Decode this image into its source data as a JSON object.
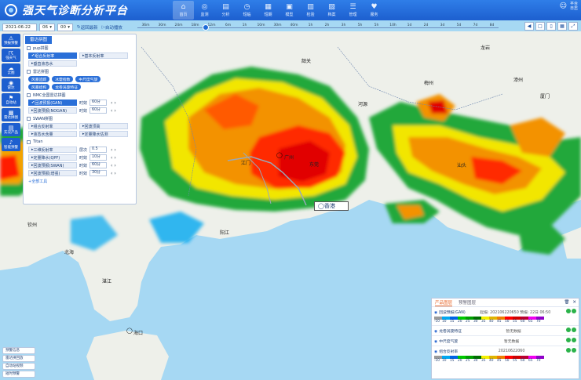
{
  "header": {
    "title": "强天气诊断分析平台",
    "nav": [
      "首页",
      "监测",
      "分析",
      "短临",
      "短期",
      "模型",
      "检验",
      "档案",
      "管理",
      "服务"
    ],
    "user": [
      "平台",
      "日志"
    ]
  },
  "timebar": {
    "date": "2021-06-22",
    "hour": "06",
    "minute": "00",
    "refresh_label": "返回最新",
    "auto_label": "自动播放",
    "ticks": [
      "36m",
      "30m",
      "24m",
      "18m",
      "12m",
      "6m",
      "1h",
      "10m",
      "30m",
      "40m",
      "1h",
      "2h",
      "3h",
      "5h",
      "5h",
      "10h",
      "1d",
      "2d",
      "3d",
      "5d",
      "7d",
      "8d"
    ]
  },
  "left_strip": [
    "预报预警",
    "强天气",
    "云图",
    "雷达",
    "自动站",
    "雷达拼图",
    "实况产品",
    "智能预警"
  ],
  "layer_panel": {
    "tab": "雷达拼图",
    "pup": "pup拼图",
    "composite": "组合反射率",
    "basic": "基本反射率",
    "echo_top": "垂直液态水",
    "quality": "雷达拼图",
    "pills": [
      "风暴追踪",
      "冰雹指数",
      "中尺度气旋",
      "风暴结构",
      "龙卷涡旋特征"
    ],
    "nmc": "NMC全国雷达拼图",
    "rows": [
      {
        "name": "回波预报(GAN)",
        "label": "时效",
        "value": "60分"
      },
      {
        "name": "回波预报(NOGAN)",
        "label": "时效",
        "value": "60分"
      }
    ],
    "swan": "SWAN拼图",
    "swan_items": [
      "组合反射率",
      "回波顶高",
      "液态水含量",
      "定量降水估测"
    ],
    "titan": "Titan",
    "titan_rows": [
      {
        "name": "三维反射率",
        "label": "层次",
        "value": "0.5"
      },
      {
        "name": "定量降水(QPF)",
        "label": "时效",
        "value": "10分"
      },
      {
        "name": "回波预报(SWAN)",
        "label": "时效",
        "value": "60分"
      },
      {
        "name": "回波预报(增强)",
        "label": "时效",
        "value": "30分"
      }
    ],
    "more": "+全部工具"
  },
  "product_panel": {
    "tabs": [
      "产品图层",
      "预警图层"
    ],
    "items": [
      {
        "name": "回波预报(GAN)",
        "meta": "起报: 202106220650  预报: 22日 06:50"
      },
      {
        "name": "龙卷涡旋特征",
        "meta": "暂无数据"
      },
      {
        "name": "中尺度气旋",
        "meta": "暂无数据"
      },
      {
        "name": "组合反射率",
        "meta": "20210622060"
      }
    ],
    "legend_values": [
      "-10",
      "10",
      "15",
      "20",
      "25",
      "30",
      "35",
      "40",
      "45",
      "50",
      "55",
      "60",
      "65",
      "70"
    ],
    "legend_colors": [
      "#9a9a9a",
      "#00a7f0",
      "#0063e6",
      "#00c900",
      "#00a000",
      "#007000",
      "#f5f000",
      "#e0b400",
      "#f07d00",
      "#ff0000",
      "#d00000",
      "#b80030",
      "#f000f0",
      "#9000c8"
    ]
  },
  "bottom_left": [
    "预警信息",
    "雷达拼回放",
    "自动站视频",
    "短时预警"
  ],
  "cities": [
    "韶关",
    "广州",
    "东莞",
    "江门",
    "阳江",
    "香港",
    "钦州",
    "北海",
    "海口",
    "湛江",
    "梅州",
    "汕头",
    "龙岩",
    "漳州",
    "厦门",
    "河源"
  ]
}
